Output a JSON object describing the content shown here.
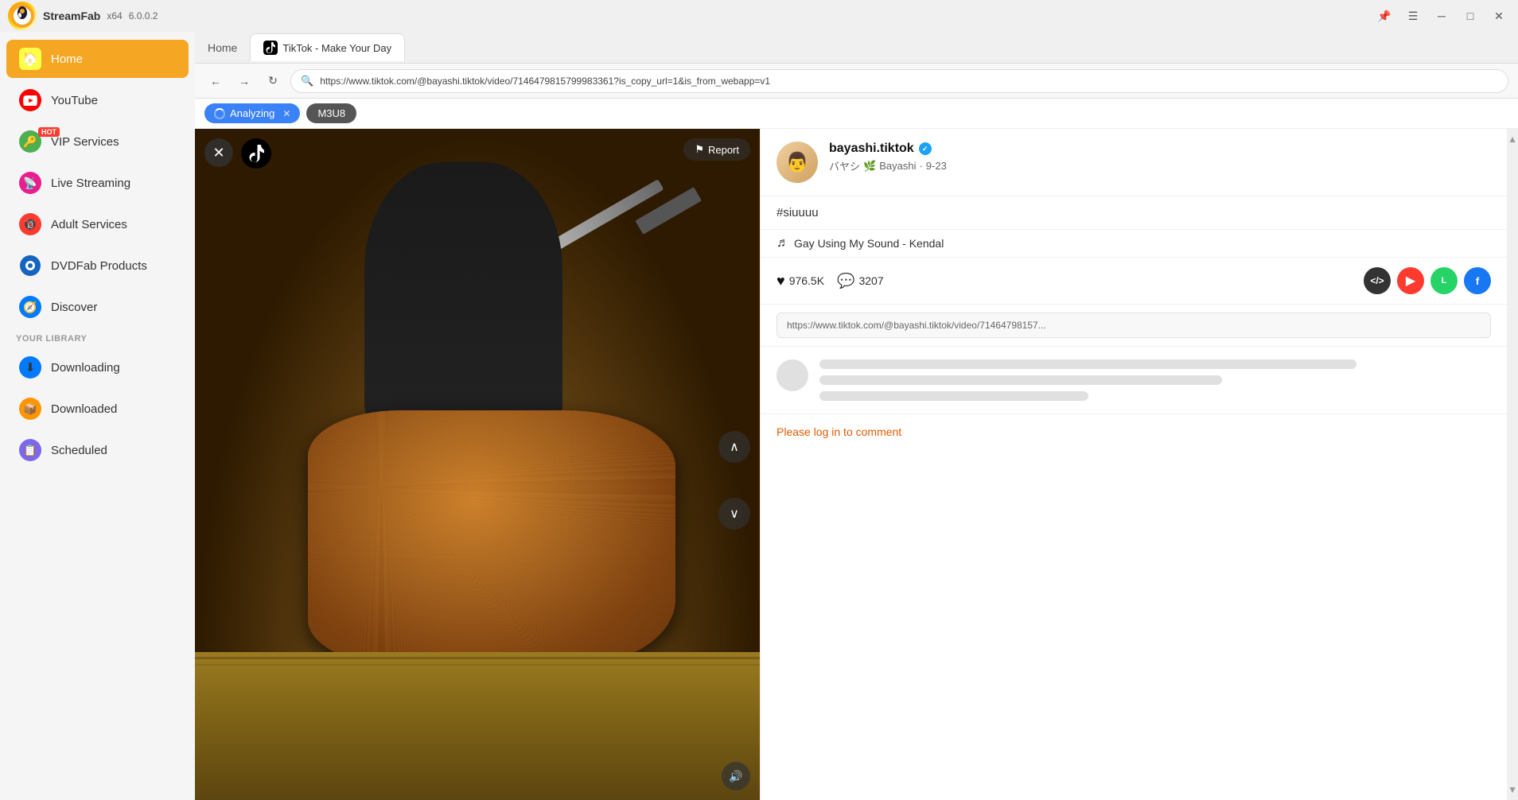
{
  "app": {
    "name": "StreamFab",
    "arch": "x64",
    "version": "6.0.0.2",
    "logo_emoji": "🎬"
  },
  "title_bar": {
    "pin_icon": "📌",
    "menu_icon": "☰",
    "minimize_icon": "─",
    "maximize_icon": "□",
    "close_icon": "✕"
  },
  "tabs": {
    "home_label": "Home",
    "tiktok_label": "TikTok - Make Your Day"
  },
  "address_bar": {
    "url": "https://www.tiktok.com/@bayashi.tiktok/video/7146479815799983361?is_copy_url=1&is_from_webapp=v1"
  },
  "toolbar": {
    "analyzing_label": "Analyzing",
    "m3u8_label": "M3U8"
  },
  "sidebar": {
    "home_label": "Home",
    "youtube_label": "YouTube",
    "vip_label": "VIP Services",
    "vip_hot": "HOT",
    "live_label": "Live Streaming",
    "adult_label": "Adult Services",
    "dvdfab_label": "DVDFab Products",
    "discover_label": "Discover",
    "library_label": "YOUR LIBRARY",
    "downloading_label": "Downloading",
    "downloaded_label": "Downloaded",
    "scheduled_label": "Scheduled"
  },
  "video": {
    "close_icon": "✕",
    "report_label": "Report",
    "nav_up_icon": "∧",
    "nav_down_icon": "∨",
    "volume_icon": "🔊"
  },
  "creator": {
    "username": "bayashi.tiktok",
    "verified": true,
    "display_name": "バヤシ",
    "emoji": "🌿",
    "platform": "Bayashi",
    "date": "9-23",
    "avatar_emoji": "👨‍🍳"
  },
  "video_meta": {
    "caption": "#siuuuu",
    "music_note": "♬",
    "music": "Gay Using My Sound - Kendal"
  },
  "stats": {
    "likes": "976.5K",
    "comments": "3207",
    "heart_icon": "♥",
    "comment_icon": "💬"
  },
  "actions": {
    "code_icon": "</>",
    "share1_icon": "▶",
    "share2_icon": "LINE",
    "share3_icon": "f"
  },
  "share": {
    "link": "https://www.tiktok.com/@bayashi.tiktok/video/71464798157..."
  },
  "comments": {
    "login_prompt": "Please log in to comment"
  }
}
